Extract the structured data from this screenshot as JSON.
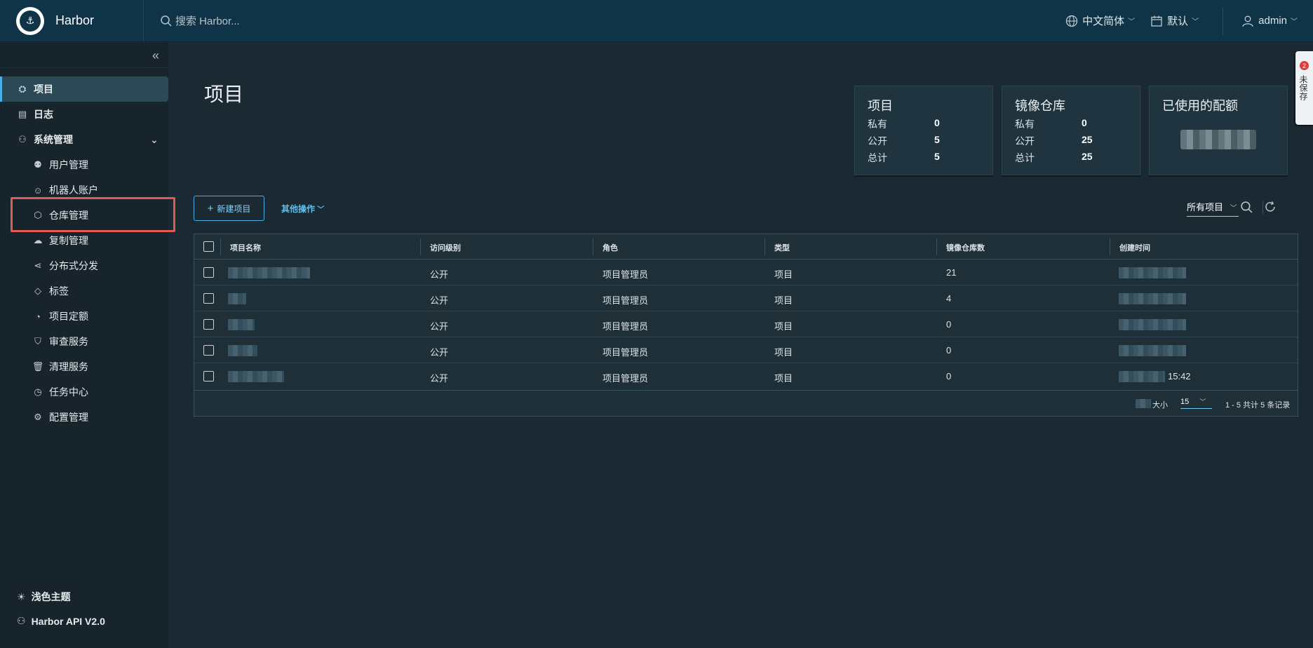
{
  "header": {
    "brand": "Harbor",
    "search_placeholder": "搜索 Harbor...",
    "language": "中文简体",
    "schedule": "默认",
    "user": "admin"
  },
  "sidebar": {
    "items": [
      {
        "label": "项目",
        "icon": "project-icon",
        "level": "top",
        "active": true
      },
      {
        "label": "日志",
        "icon": "log-icon",
        "level": "top"
      },
      {
        "label": "系统管理",
        "icon": "admin-icon",
        "level": "top"
      },
      {
        "label": "用户管理",
        "icon": "users-icon",
        "level": "sub"
      },
      {
        "label": "机器人账户",
        "icon": "robot-icon",
        "level": "sub"
      },
      {
        "label": "仓库管理",
        "icon": "cube-icon",
        "level": "sub"
      },
      {
        "label": "复制管理",
        "icon": "replication-icon",
        "level": "sub"
      },
      {
        "label": "分布式分发",
        "icon": "share-icon",
        "level": "sub"
      },
      {
        "label": "标签",
        "icon": "tag-icon",
        "level": "sub"
      },
      {
        "label": "项目定额",
        "icon": "quota-icon",
        "level": "sub"
      },
      {
        "label": "审查服务",
        "icon": "shield-icon",
        "level": "sub"
      },
      {
        "label": "清理服务",
        "icon": "trash-icon",
        "level": "sub"
      },
      {
        "label": "任务中心",
        "icon": "dashboard-icon",
        "level": "sub"
      },
      {
        "label": "配置管理",
        "icon": "gear-icon",
        "level": "sub"
      }
    ],
    "theme_label": "浅色主题",
    "api_label": "Harbor API V2.0"
  },
  "main": {
    "title": "项目",
    "cards": {
      "projects": {
        "title": "项目",
        "private_label": "私有",
        "private": "0",
        "public_label": "公开",
        "public": "5",
        "total_label": "总计",
        "total": "5"
      },
      "repos": {
        "title": "镜像仓库",
        "private_label": "私有",
        "private": "0",
        "public_label": "公开",
        "public": "25",
        "total_label": "总计",
        "total": "25"
      },
      "quota": {
        "title": "已使用的配额"
      }
    },
    "new_project": "新建项目",
    "more_actions": "其他操作",
    "filter": "所有项目",
    "table": {
      "columns": [
        "项目名称",
        "访问级别",
        "角色",
        "类型",
        "镜像仓库数",
        "创建时间"
      ],
      "rows": [
        {
          "access": "公开",
          "role": "项目管理员",
          "type": "项目",
          "repos": "21"
        },
        {
          "access": "公开",
          "role": "项目管理员",
          "type": "项目",
          "repos": "4"
        },
        {
          "access": "公开",
          "role": "项目管理员",
          "type": "项目",
          "repos": "0"
        },
        {
          "access": "公开",
          "role": "项目管理员",
          "type": "项目",
          "repos": "0"
        },
        {
          "access": "公开",
          "role": "项目管理员",
          "type": "项目",
          "repos": "0",
          "time_suffix": "15:42"
        }
      ],
      "page_size_label": "大小",
      "page_size": "15",
      "summary": "1 - 5 共计 5 条记录"
    }
  },
  "float_tab": {
    "badge": "2",
    "text": "未保存"
  }
}
